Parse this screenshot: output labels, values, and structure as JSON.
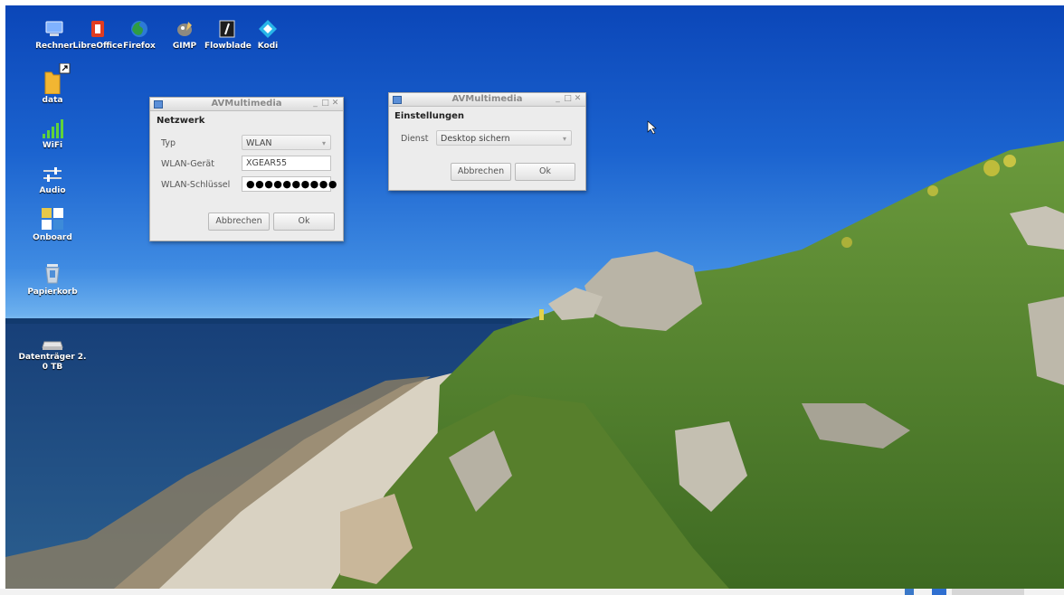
{
  "desktop": {
    "top_icons": [
      {
        "label": "Rechner",
        "icon": "computer-icon"
      },
      {
        "label": "LibreOffice",
        "icon": "libreoffice-icon"
      },
      {
        "label": "Firefox",
        "icon": "firefox-icon"
      },
      {
        "label": "GIMP",
        "icon": "gimp-icon"
      },
      {
        "label": "Flowblade",
        "icon": "flowblade-icon"
      },
      {
        "label": "Kodi",
        "icon": "kodi-icon"
      }
    ],
    "left_icons": [
      {
        "label": "data",
        "icon": "folder-link-icon"
      },
      {
        "label": "WiFi",
        "icon": "wifi-signal-icon"
      },
      {
        "label": "Audio",
        "icon": "audio-mixer-icon"
      },
      {
        "label": "Onboard",
        "icon": "onboard-keyboard-icon"
      },
      {
        "label": "Papierkorb",
        "icon": "trash-icon"
      },
      {
        "label": "Datenträger 2.",
        "label2": "0 TB",
        "icon": "drive-icon"
      }
    ]
  },
  "dialog_network": {
    "title": "AVMultimedia",
    "heading": "Netzwerk",
    "type_label": "Typ",
    "type_value": "WLAN",
    "device_label": "WLAN-Gerät",
    "device_value": "XGEAR55",
    "key_label": "WLAN-Schlüssel",
    "key_value": "●●●●●●●●●●",
    "cancel_label": "Abbrechen",
    "ok_label": "Ok"
  },
  "dialog_settings": {
    "title": "AVMultimedia",
    "heading": "Einstellungen",
    "service_label": "Dienst",
    "service_value": "Desktop sichern",
    "cancel_label": "Abbrechen",
    "ok_label": "Ok"
  },
  "colors": {
    "sky_top": "#0b46b8",
    "sea": "#1d4f86",
    "grass": "#4f7d2e",
    "dialog_bg": "#ececec"
  }
}
